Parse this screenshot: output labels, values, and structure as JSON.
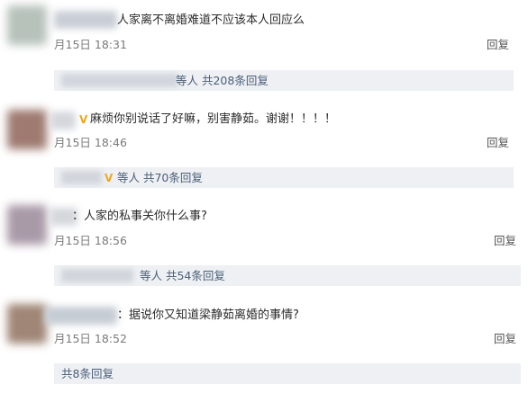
{
  "comments": [
    {
      "text": "人家离不离婚难道不应该本人回应么",
      "time": "月15日 18:31",
      "reply_label": "回复",
      "thread_summary": "等人 共208条回复"
    },
    {
      "text": "麻烦你别说话了好嘛，别害静茹。谢谢！！！！",
      "time": "月15日 18:46",
      "reply_label": "回复",
      "thread_summary": "等人 共70条回复"
    },
    {
      "text": "：人家的私事关你什么事?",
      "time": "月15日 18:56",
      "reply_label": "回复",
      "thread_summary": "等人 共54条回复"
    },
    {
      "text": "：据说你又知道梁静茹离婚的事情?",
      "time": "月15日 18:52",
      "reply_label": "回复",
      "thread_summary": "共8条回复"
    }
  ],
  "vip_badge": "V",
  "colon": "：",
  "colors": {
    "thread_text": "#4a5f7a",
    "thread_bg": "#eef0f3",
    "vip_badge": "#f0a81a"
  }
}
